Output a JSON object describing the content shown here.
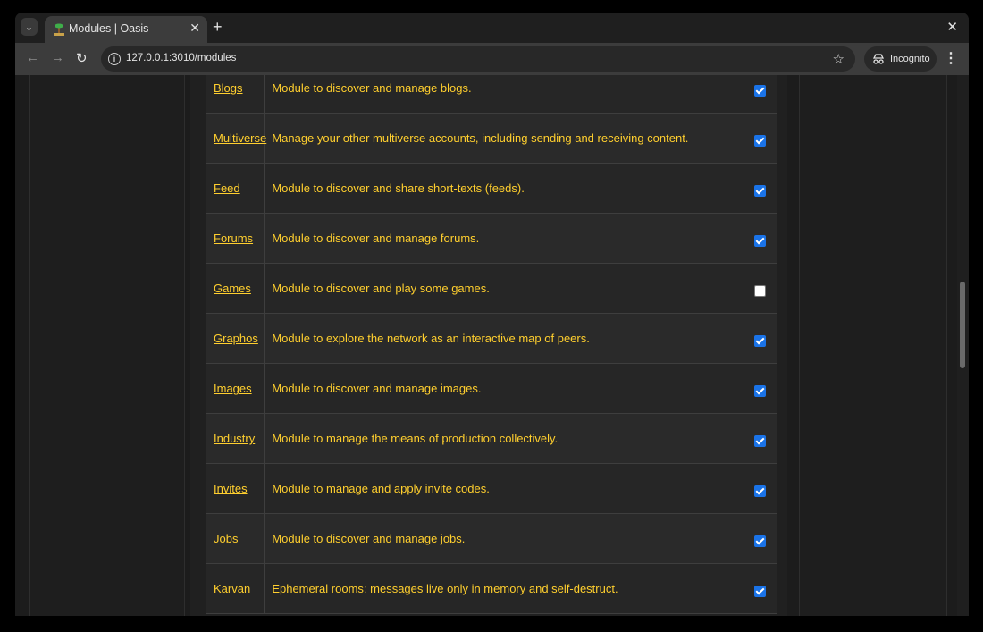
{
  "browser": {
    "tab_title": "Modules | Oasis",
    "tab_close": "✕",
    "new_tab": "+",
    "window_close": "✕",
    "url": "127.0.0.1:3010/modules",
    "incognito_label": "Incognito",
    "icons": [
      "tab-search-icon",
      "back-icon",
      "forward-icon",
      "reload-icon",
      "site-info-icon",
      "star-icon",
      "incognito-icon",
      "menu-icon"
    ]
  },
  "modules": [
    {
      "name": "Blogs",
      "description": "Module to discover and manage blogs.",
      "enabled": true
    },
    {
      "name": "Multiverse",
      "description": "Manage your other multiverse accounts, including sending and receiving content.",
      "enabled": true
    },
    {
      "name": "Feed",
      "description": "Module to discover and share short-texts (feeds).",
      "enabled": true
    },
    {
      "name": "Forums",
      "description": "Module to discover and manage forums.",
      "enabled": true
    },
    {
      "name": "Games",
      "description": "Module to discover and play some games.",
      "enabled": false
    },
    {
      "name": "Graphos",
      "description": "Module to explore the network as an interactive map of peers.",
      "enabled": true
    },
    {
      "name": "Images",
      "description": "Module to discover and manage images.",
      "enabled": true
    },
    {
      "name": "Industry",
      "description": "Module to manage the means of production collectively.",
      "enabled": true
    },
    {
      "name": "Invites",
      "description": "Module to manage and apply invite codes.",
      "enabled": true
    },
    {
      "name": "Jobs",
      "description": "Module to discover and manage jobs.",
      "enabled": true
    },
    {
      "name": "Karvan",
      "description": "Ephemeral rooms: messages live only in memory and self-destruct.",
      "enabled": true
    }
  ],
  "colors": {
    "link": "#ffcf2e",
    "checkbox_checked": "#1a73e8",
    "page_bg": "#1c1c1c"
  }
}
